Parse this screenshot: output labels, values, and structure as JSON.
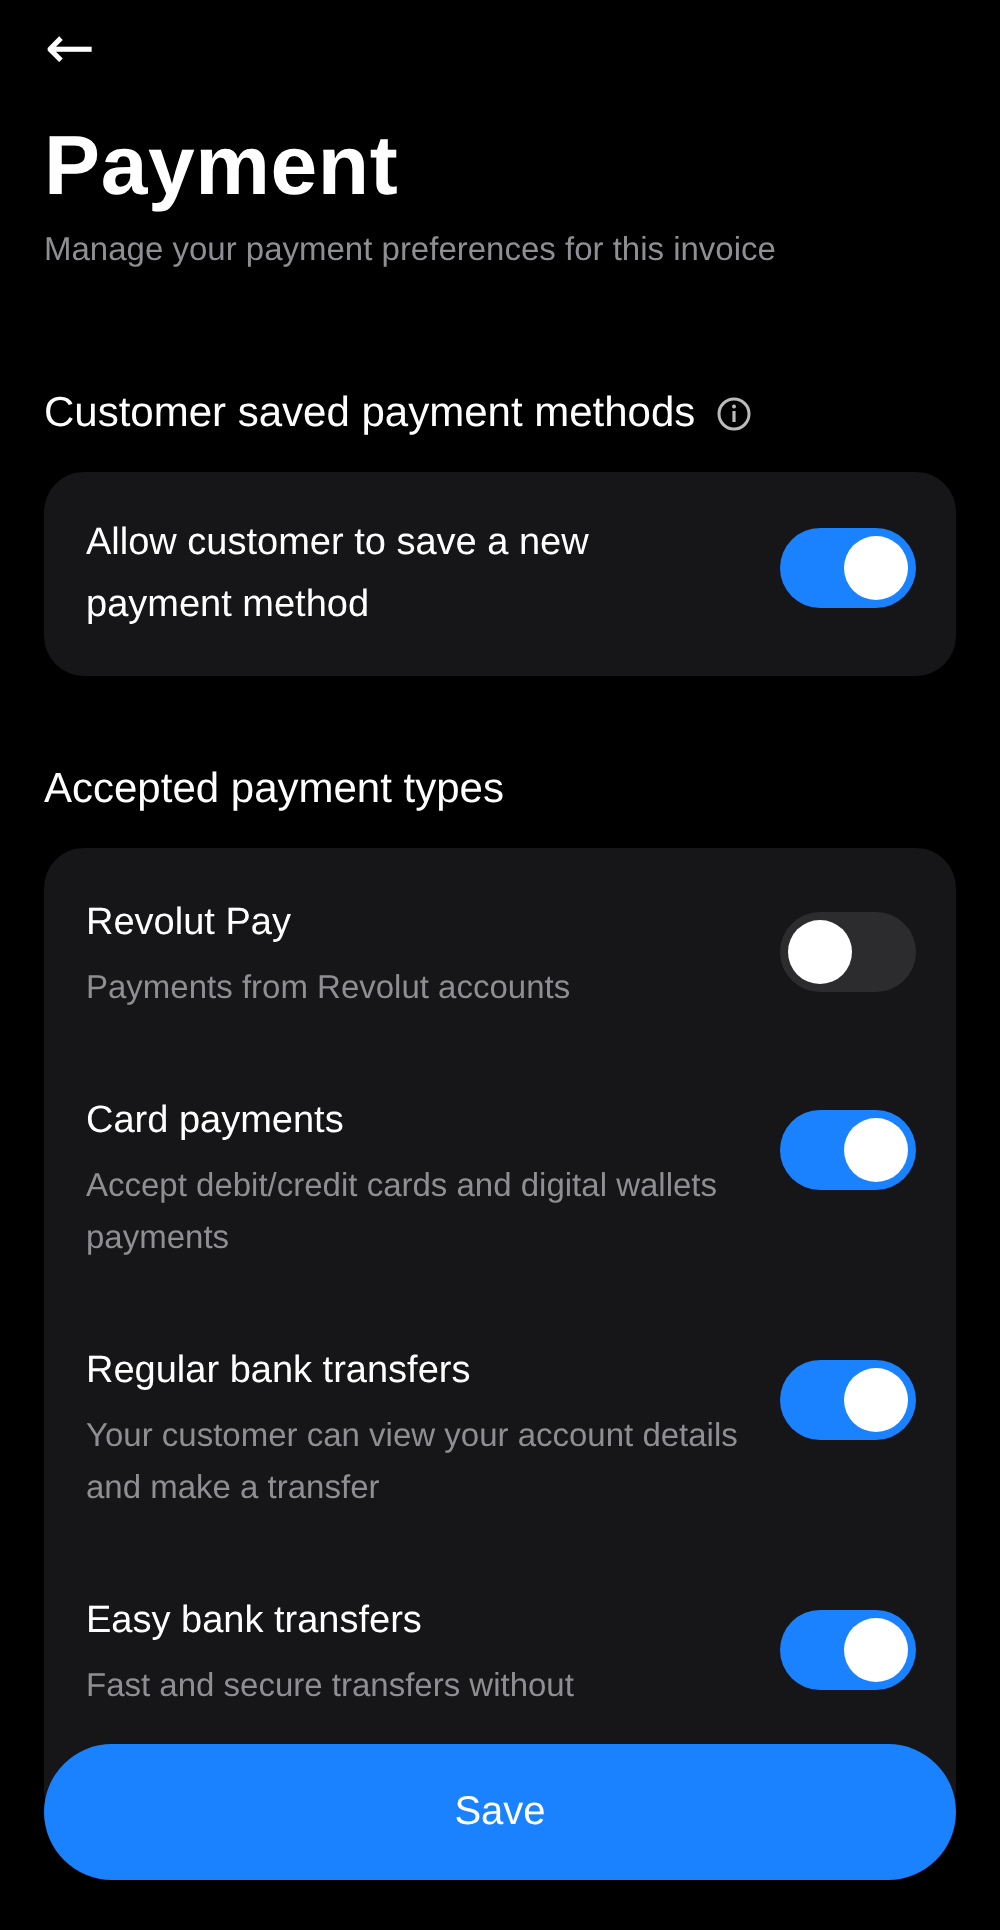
{
  "header": {
    "back": "←",
    "title": "Payment",
    "subtitle": "Manage your payment preferences for this invoice"
  },
  "saved_methods": {
    "heading": "Customer saved payment methods",
    "items": [
      {
        "label": "Allow customer to save a new payment method",
        "on": true
      }
    ]
  },
  "payment_types": {
    "heading": "Accepted payment types",
    "items": [
      {
        "label": "Revolut Pay",
        "description": "Payments from Revolut accounts",
        "on": false
      },
      {
        "label": "Card payments",
        "description": "Accept debit/credit cards and digital wallets payments",
        "on": true
      },
      {
        "label": "Regular bank transfers",
        "description": "Your customer can view your account details and make a transfer",
        "on": true
      },
      {
        "label": "Easy bank transfers",
        "description": "Fast and secure transfers without",
        "on": true
      }
    ]
  },
  "save_button": "Save"
}
